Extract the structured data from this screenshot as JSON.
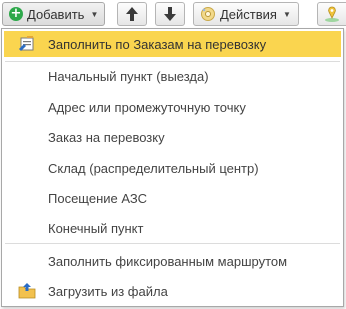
{
  "toolbar": {
    "add_label": "Добавить",
    "actions_label": "Действия"
  },
  "menu": {
    "items": [
      {
        "label": "Заполнить по Заказам на перевозку",
        "icon": "fill-orders-icon"
      },
      {
        "label": "Начальный пункт (выезда)"
      },
      {
        "label": "Адрес или промежуточную точку"
      },
      {
        "label": "Заказ на перевозку"
      },
      {
        "label": "Склад (распределительный центр)"
      },
      {
        "label": "Посещение АЗС"
      },
      {
        "label": "Конечный пункт"
      },
      {
        "label": "Заполнить фиксированным маршрутом"
      },
      {
        "label": "Загрузить из файла",
        "icon": "folder-upload-icon"
      }
    ]
  },
  "colors": {
    "highlight": "#fad54f",
    "add_icon": "#2da84a"
  }
}
